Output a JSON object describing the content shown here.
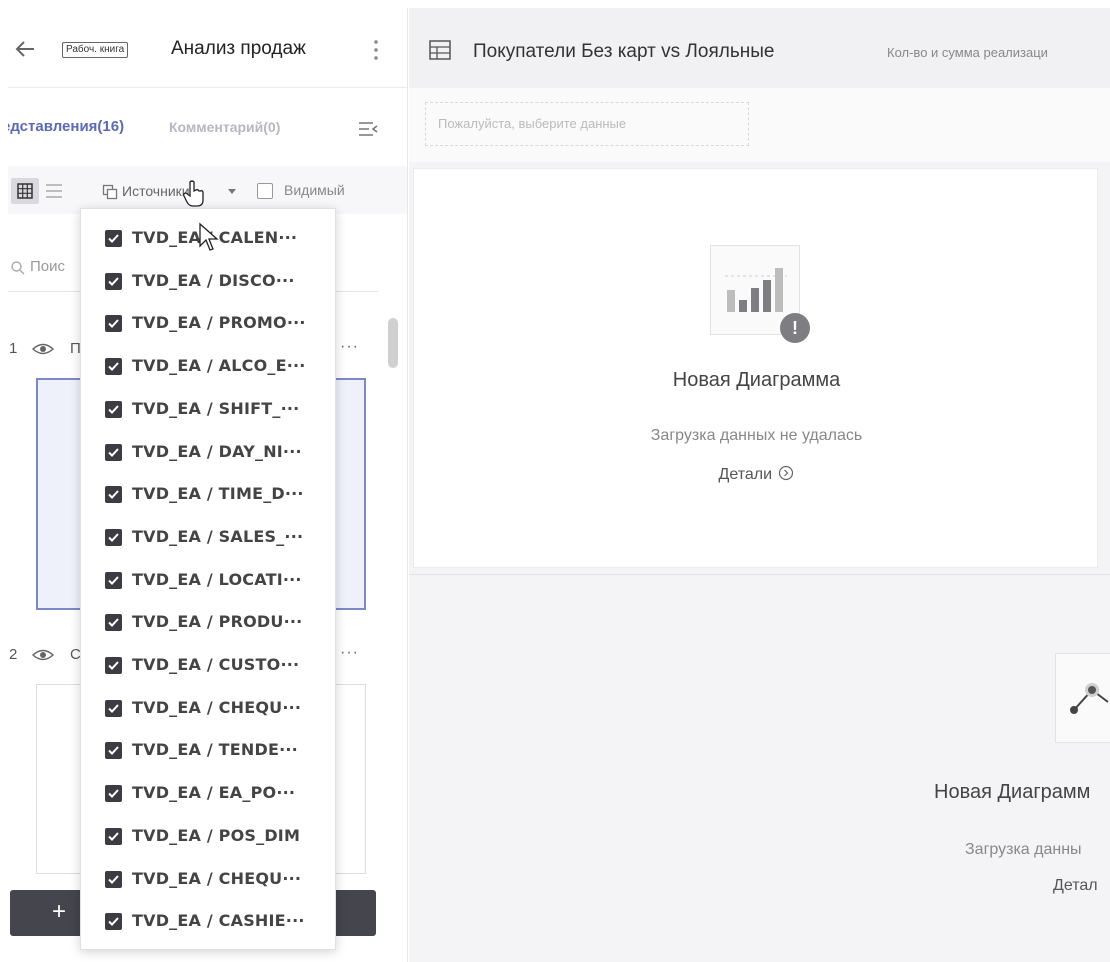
{
  "left_panel": {
    "badge": "Рабоч. книга",
    "title": "Анализ продаж",
    "tabs": {
      "views": "едставления(16)",
      "comments": "Комментарий(0)"
    },
    "toolbar": {
      "sources": "Источники",
      "visible": "Видимый"
    },
    "search_placeholder": "Поис",
    "rows": [
      {
        "num": "1",
        "letter": "П",
        "more": "···"
      },
      {
        "num": "2",
        "letter": "С",
        "more": "···"
      }
    ],
    "add_label": "+"
  },
  "dropdown": {
    "items": [
      "TVD_EA / CALEN···",
      "TVD_EA / DISCO···",
      "TVD_EA / PROMO···",
      "TVD_EA / ALCO_E···",
      "TVD_EA / SHIFT_···",
      "TVD_EA / DAY_NI···",
      "TVD_EA / TIME_D···",
      "TVD_EA / SALES_···",
      "TVD_EA / LOCATI···",
      "TVD_EA / PRODU···",
      "TVD_EA / CUSTO···",
      "TVD_EA / CHEQU···",
      "TVD_EA / TENDE···",
      "TVD_EA / EA_PO···",
      "TVD_EA / POS_DIM",
      "TVD_EA / CHEQU···",
      "TVD_EA / CASHIE···"
    ],
    "checked": true
  },
  "right_area": {
    "title": "Покупатели Без карт vs Лояльные",
    "subtitle": "Кол-во и сумма реализаци",
    "filter_placeholder": "Пожалуйста, выберите данные",
    "chart1": {
      "title": "Новая Диаграмма",
      "error": "Загрузка данных не удалась",
      "details": "Детали",
      "warning": "!"
    },
    "chart2": {
      "title": "Новая Диаграмм",
      "error": "Загрузка данны",
      "details": "Детал"
    }
  },
  "colors": {
    "accent": "#5a6ab8",
    "selected_border": "#7c88c7",
    "dark_button": "#44454d"
  }
}
